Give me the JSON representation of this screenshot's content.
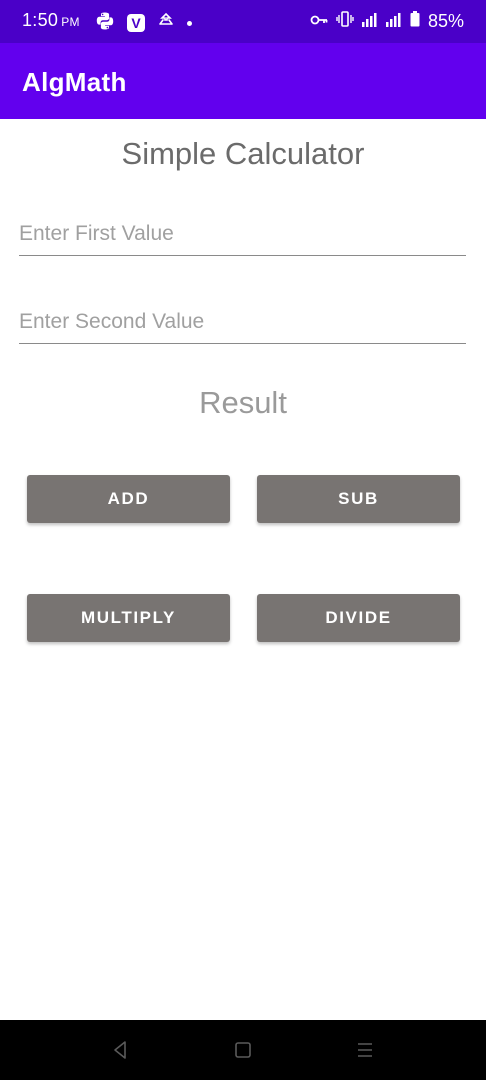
{
  "status_bar": {
    "time": "1:50",
    "ampm": "PM",
    "battery": "85%",
    "icons": [
      "python-icon",
      "v-app-icon",
      "sync-icon",
      "notification-dot-icon",
      "vpn-key-icon",
      "vibrate-icon",
      "signal-icon",
      "signal-icon",
      "battery-icon"
    ],
    "v_badge": "V"
  },
  "app_bar": {
    "title": "AlgMath",
    "color": "#6200ee"
  },
  "main": {
    "title": "Simple Calculator",
    "first_value": {
      "value": "",
      "placeholder": "Enter First Value"
    },
    "second_value": {
      "value": "",
      "placeholder": "Enter Second Value"
    },
    "result": "Result",
    "buttons": {
      "add": "ADD",
      "sub": "SUB",
      "multiply": "MULTIPLY",
      "divide": "DIVIDE"
    },
    "button_color": "#787472"
  },
  "nav_bar": {
    "icons": [
      "back-icon",
      "home-icon",
      "recents-icon"
    ]
  }
}
